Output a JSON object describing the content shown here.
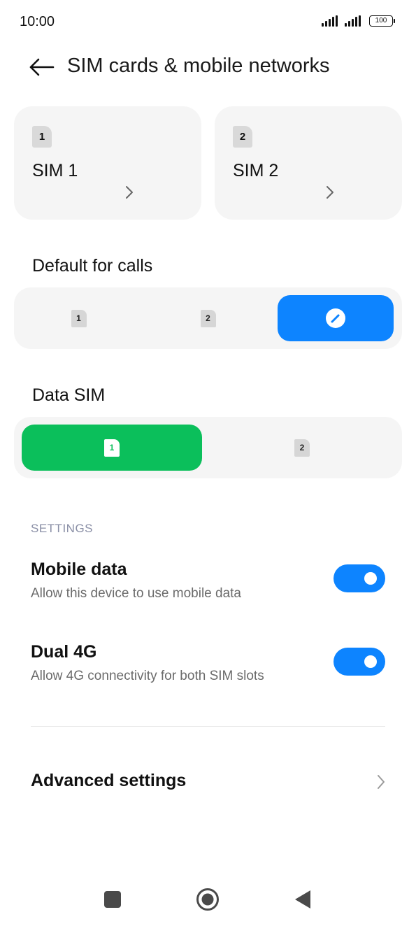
{
  "status": {
    "time": "10:00",
    "battery": "100"
  },
  "header": {
    "title": "SIM cards & mobile networks"
  },
  "sims": [
    {
      "badge": "1",
      "label": "SIM 1"
    },
    {
      "badge": "2",
      "label": "SIM 2"
    }
  ],
  "calls": {
    "label": "Default for calls",
    "options": [
      "1",
      "2"
    ],
    "selected": "ask-every-time",
    "accent": "#0d84ff"
  },
  "data_sim": {
    "label": "Data SIM",
    "options": [
      "1",
      "2"
    ],
    "selected": "1",
    "accent": "#0bbf5b"
  },
  "settings": {
    "header": "SETTINGS",
    "mobile_data": {
      "title": "Mobile data",
      "subtitle": "Allow this device to use mobile data",
      "enabled": true
    },
    "dual_4g": {
      "title": "Dual 4G",
      "subtitle": "Allow 4G connectivity for both SIM slots",
      "enabled": true
    },
    "advanced": {
      "title": "Advanced settings"
    }
  },
  "nav": {
    "icons": [
      "recents-icon",
      "home-icon",
      "back-icon"
    ]
  }
}
